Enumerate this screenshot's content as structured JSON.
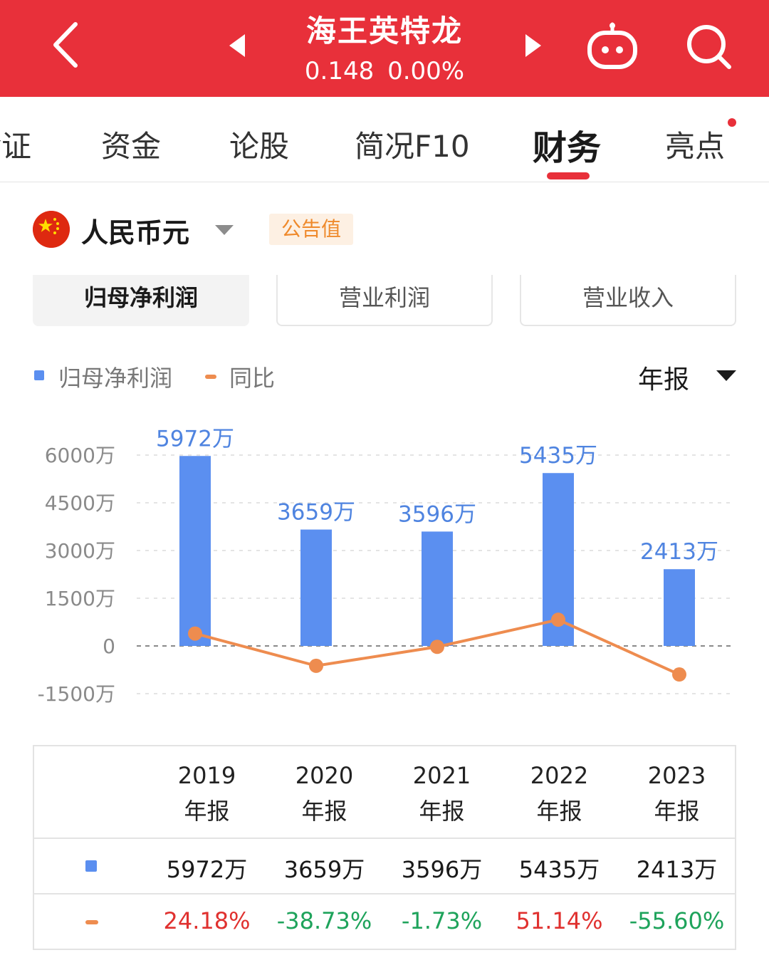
{
  "header": {
    "title": "海王英特龙",
    "price": "0.148",
    "change": "0.00%",
    "bg_color": "#e8303a"
  },
  "tabs": [
    {
      "label": "诊证"
    },
    {
      "label": "资金"
    },
    {
      "label": "论股"
    },
    {
      "label": "简况F10"
    },
    {
      "label": "财务",
      "active": true
    },
    {
      "label": "亮点",
      "has_dot": true
    }
  ],
  "currency": {
    "label": "人民币元",
    "badge": "公告值"
  },
  "segments": [
    {
      "label": "归母净利润",
      "active": true
    },
    {
      "label": "营业利润"
    },
    {
      "label": "营业收入"
    }
  ],
  "legend": {
    "series1": "归母净利润",
    "series2": "同比"
  },
  "period": "年报",
  "chart_data": {
    "type": "bar",
    "categories": [
      "2019年报",
      "2020年报",
      "2021年报",
      "2022年报",
      "2023年报"
    ],
    "series": [
      {
        "name": "归母净利润",
        "type": "bar",
        "values": [
          5972,
          3659,
          3596,
          5435,
          2413
        ],
        "labels": [
          "5972万",
          "3659万",
          "3596万",
          "5435万",
          "2413万"
        ],
        "color": "#5b8ff0"
      },
      {
        "name": "同比",
        "type": "line",
        "values": [
          24.18,
          -38.73,
          -1.73,
          51.14,
          -55.6
        ],
        "color": "#ee8c4f"
      }
    ],
    "yticks": [
      "6000万",
      "4500万",
      "3000万",
      "1500万",
      "0",
      "-1500万"
    ],
    "ylim": [
      -1500,
      6000
    ]
  },
  "table": {
    "years": [
      {
        "year": "2019",
        "type": "年报"
      },
      {
        "year": "2020",
        "type": "年报"
      },
      {
        "year": "2021",
        "type": "年报"
      },
      {
        "year": "2022",
        "type": "年报"
      },
      {
        "year": "2023",
        "type": "年报"
      }
    ],
    "profit": [
      "5972万",
      "3659万",
      "3596万",
      "5435万",
      "2413万"
    ],
    "yoy": [
      "24.18%",
      "-38.73%",
      "-1.73%",
      "51.14%",
      "-55.60%"
    ]
  }
}
